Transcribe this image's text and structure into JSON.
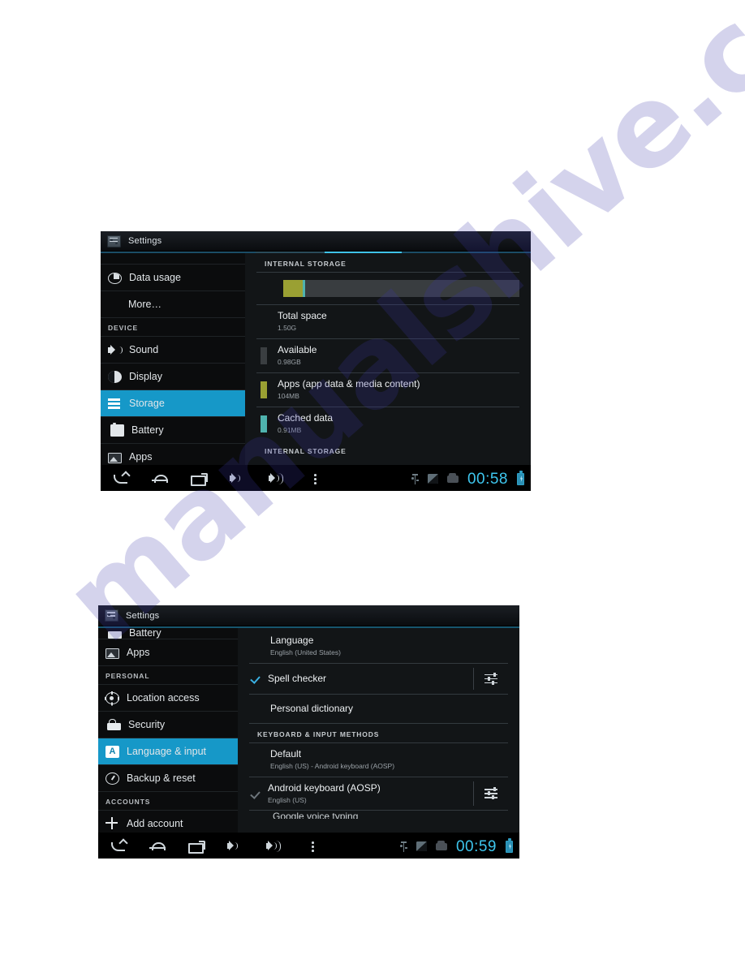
{
  "page": {
    "background": "#ffffff",
    "watermark": "manualshive.com",
    "watermark_color": "#3c37aa"
  },
  "screenshots": [
    {
      "id": "storage",
      "titlebar": {
        "app_icon": "settings-gear-icon",
        "title": "Settings"
      },
      "sidebar": {
        "partial_top_item": {
          "label": "",
          "icon": "partial-row"
        },
        "items": [
          {
            "label": "Data usage",
            "icon": "data-usage-icon",
            "selected": false,
            "type": "item"
          },
          {
            "label": "More…",
            "icon": "none",
            "selected": false,
            "type": "item-noicon"
          },
          {
            "label": "DEVICE",
            "icon": "none",
            "selected": false,
            "type": "header"
          },
          {
            "label": "Sound",
            "icon": "sound-icon",
            "selected": false,
            "type": "item"
          },
          {
            "label": "Display",
            "icon": "display-icon",
            "selected": false,
            "type": "item"
          },
          {
            "label": "Storage",
            "icon": "storage-icon",
            "selected": true,
            "type": "item"
          },
          {
            "label": "Battery",
            "icon": "battery-icon",
            "selected": false,
            "type": "item"
          },
          {
            "label": "Apps",
            "icon": "apps-icon",
            "selected": false,
            "type": "item"
          }
        ]
      },
      "content": {
        "section_title": "INTERNAL STORAGE",
        "footer_section_title": "INTERNAL STORAGE",
        "usage_bar": {
          "segments": [
            {
              "name": "apps",
              "color": "#9aa033",
              "percent": 8.2
            },
            {
              "name": "cached",
              "color": "#4fb3ae",
              "percent": 1.2
            },
            {
              "name": "free",
              "color": "#393d40",
              "percent": 90.6
            }
          ]
        },
        "rows": [
          {
            "title": "Total space",
            "value": "1.50G",
            "swatch": "none",
            "indent": true
          },
          {
            "title": "Available",
            "value": "0.98GB",
            "swatch": "#3a3e41",
            "indent": false
          },
          {
            "title": "Apps (app data & media content)",
            "value": "104MB",
            "swatch": "#9aa033",
            "indent": false
          },
          {
            "title": "Cached data",
            "value": "0.91MB",
            "swatch": "#4fb3ae",
            "indent": false
          }
        ]
      },
      "sysbar": {
        "nav": [
          "back-icon",
          "home-icon",
          "recents-icon",
          "volume-down-icon",
          "volume-up-icon",
          "overflow-menu-icon"
        ],
        "status_icons": [
          "usb-icon",
          "sd-card-icon",
          "storage-card-icon"
        ],
        "clock": "00:58",
        "battery": "battery-charging-icon"
      }
    },
    {
      "id": "language",
      "titlebar": {
        "app_icon": "settings-gear-icon",
        "title": "Settings"
      },
      "sidebar": {
        "partial_top_item": {
          "label": "Battery",
          "icon": "battery-icon"
        },
        "items": [
          {
            "label": "Apps",
            "icon": "apps-icon",
            "selected": false,
            "type": "item"
          },
          {
            "label": "PERSONAL",
            "icon": "none",
            "selected": false,
            "type": "header"
          },
          {
            "label": "Location access",
            "icon": "location-icon",
            "selected": false,
            "type": "item"
          },
          {
            "label": "Security",
            "icon": "lock-icon",
            "selected": false,
            "type": "item"
          },
          {
            "label": "Language & input",
            "icon": "language-icon",
            "selected": true,
            "type": "item"
          },
          {
            "label": "Backup & reset",
            "icon": "backup-icon",
            "selected": false,
            "type": "item"
          },
          {
            "label": "ACCOUNTS",
            "icon": "none",
            "selected": false,
            "type": "header"
          },
          {
            "label": "Add account",
            "icon": "plus-icon",
            "selected": false,
            "type": "item"
          }
        ]
      },
      "content": {
        "language_row": {
          "title": "Language",
          "value": "English (United States)"
        },
        "spell_checker": {
          "title": "Spell checker",
          "checked": true,
          "settings_icon": "sliders-icon"
        },
        "personal_dict": {
          "title": "Personal dictionary"
        },
        "section_title": "KEYBOARD & INPUT METHODS",
        "default_row": {
          "title": "Default",
          "value": "English (US) - Android keyboard (AOSP)"
        },
        "aosp_row": {
          "title": "Android keyboard (AOSP)",
          "value": "English (US)",
          "checked": true,
          "settings_icon": "sliders-icon"
        },
        "cut_row": {
          "title": "Google voice typing"
        }
      },
      "sysbar": {
        "nav": [
          "back-icon",
          "home-icon",
          "recents-icon",
          "volume-down-icon",
          "volume-up-icon",
          "overflow-menu-icon"
        ],
        "status_icons": [
          "usb-icon",
          "sd-card-icon",
          "storage-card-icon"
        ],
        "clock": "00:59",
        "battery": "battery-charging-icon"
      }
    }
  ]
}
